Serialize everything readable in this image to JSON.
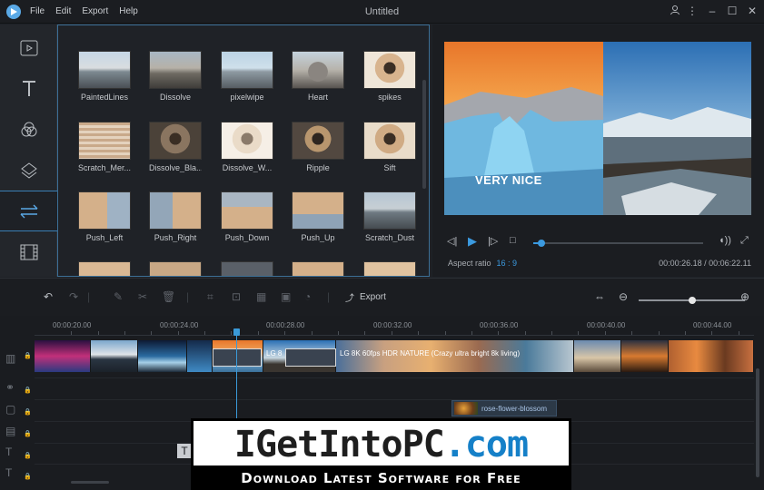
{
  "titlebar": {
    "menu": [
      "File",
      "Edit",
      "Export",
      "Help"
    ],
    "title": "Untitled",
    "icons": [
      "user-icon",
      "more-icon",
      "minimize-icon",
      "maximize-icon",
      "close-icon"
    ]
  },
  "sidebar": {
    "items": [
      "media-icon",
      "text-icon",
      "filters-icon",
      "overlays-icon",
      "transitions-icon",
      "elements-icon"
    ],
    "active": "transitions-icon"
  },
  "library": {
    "tiles": [
      {
        "label": "PaintedLines"
      },
      {
        "label": "Dissolve"
      },
      {
        "label": "pixelwipe"
      },
      {
        "label": "Heart"
      },
      {
        "label": "spikes"
      },
      {
        "label": "Scratch_Mer..."
      },
      {
        "label": "Dissolve_Bla..."
      },
      {
        "label": "Dissolve_W..."
      },
      {
        "label": "Ripple"
      },
      {
        "label": "Sift"
      },
      {
        "label": "Push_Left"
      },
      {
        "label": "Push_Right"
      },
      {
        "label": "Push_Down"
      },
      {
        "label": "Push_Up"
      },
      {
        "label": "Scratch_Dust"
      },
      {
        "label": ""
      },
      {
        "label": ""
      },
      {
        "label": ""
      },
      {
        "label": ""
      },
      {
        "label": ""
      }
    ]
  },
  "preview": {
    "overlay_text": "VERY NICE",
    "aspect_label": "Aspect ratio",
    "aspect_value": "16 : 9",
    "timecode": "00:00:26.18 / 00:06:22.11",
    "progress": 0.05
  },
  "toolbar": {
    "export_label": "Export",
    "zoom_level": 0.5
  },
  "timeline": {
    "ruler": [
      "00:00:20.00",
      "00:00:24.00",
      "00:00:28.00",
      "00:00:32.00",
      "00:00:36.00",
      "00:00:40.00",
      "00:00:44.00"
    ],
    "clip_text_1": "LG 8",
    "clip_text_2": "LG 8K 60fps HDR NATURE (Crazy ultra bright 8k living)",
    "music_clip": "rose-flower-blossom"
  },
  "banner": {
    "part1": "IGetIntoPC",
    "part2": ".com",
    "subtitle": "Download Latest Software for Free"
  },
  "colors": {
    "accent": "#3b9ae0",
    "background": "#1e2126",
    "banner_blue": "#1580c8"
  }
}
